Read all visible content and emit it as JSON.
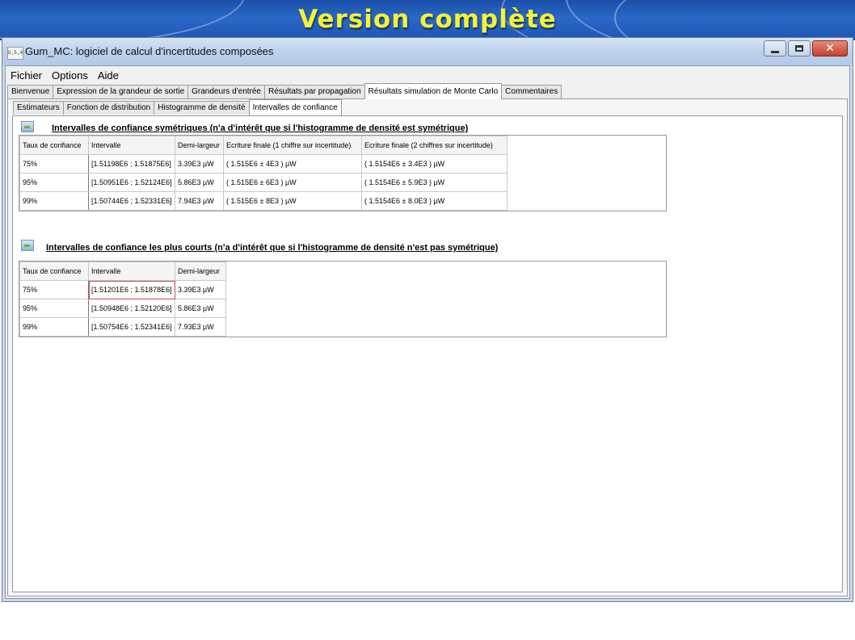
{
  "slide": {
    "title": "Version complète"
  },
  "window": {
    "icon_text": "U,5,40,1",
    "title": "Gum_MC: logiciel de calcul d'incertitudes composées",
    "close_glyph": "✕"
  },
  "menu": [
    "Fichier",
    "Options",
    "Aide"
  ],
  "main_tabs": [
    {
      "label": "Bienvenue",
      "active": false
    },
    {
      "label": "Expression de la grandeur de sortie",
      "active": false
    },
    {
      "label": "Grandeurs d'entrée",
      "active": false
    },
    {
      "label": "Résultats par propagation",
      "active": false
    },
    {
      "label": "Résultats simulation de Monte Carlo",
      "active": true
    },
    {
      "label": "Commentaires",
      "active": false
    }
  ],
  "sub_tabs": [
    {
      "label": "Estimateurs",
      "active": false
    },
    {
      "label": "Fonction de distribution",
      "active": false
    },
    {
      "label": "Histogramme de densité",
      "active": false
    },
    {
      "label": "Intervalles de confiance",
      "active": true
    }
  ],
  "symmetric": {
    "title": "Intervalles de confiance symétriques (n'a d'intérêt que si l'histogramme de densité est symétrique)",
    "headers": [
      "Taux de confiance",
      "Intervalle",
      "Demi-largeur",
      "Ecriture finale (1 chiffre sur incertitude)",
      "Ecriture finale (2 chiffres sur incertitude)"
    ],
    "rows": [
      [
        "75%",
        "[1.51198E6 ; 1.51875E6]",
        "3.39E3 µW",
        "( 1.515E6 ± 4E3 ) µW",
        "( 1.5154E6 ± 3.4E3 ) µW"
      ],
      [
        "95%",
        "[1.50951E6 ; 1.52124E6]",
        "5.86E3 µW",
        "( 1.515E6 ± 6E3 ) µW",
        "( 1.5154E6 ± 5.9E3 ) µW"
      ],
      [
        "99%",
        "[1.50744E6 ; 1.52331E6]",
        "7.94E3 µW",
        "( 1.515E6 ± 8E3 ) µW",
        "( 1.5154E6 ± 8.0E3 ) µW"
      ]
    ]
  },
  "shortest": {
    "title": "Intervalles de confiance les plus courts (n'a d'intérêt que si l'histogramme de densité n'est pas symétrique)",
    "headers": [
      "Taux de confiance",
      "Intervalle",
      "Demi-largeur"
    ],
    "rows": [
      [
        "75%",
        "[1.51201E6 ; 1.51878E6]",
        "3.39E3 µW"
      ],
      [
        "95%",
        "[1.50948E6 ; 1.52120E6]",
        "5.86E3 µW"
      ],
      [
        "99%",
        "[1.50754E6 ; 1.52341E6]",
        "7.93E3 µW"
      ]
    ]
  }
}
